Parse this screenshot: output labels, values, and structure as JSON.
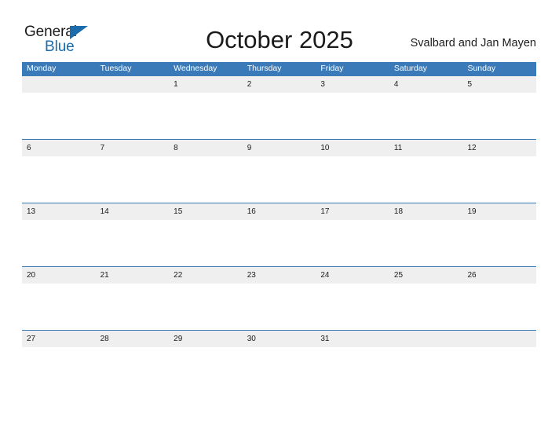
{
  "logo": {
    "text_dark": "General",
    "text_blue": "Blue",
    "triangle_icon": "triangle-icon",
    "brand_blue": "#1b6cac"
  },
  "header": {
    "title": "October 2025",
    "region": "Svalbard and Jan Mayen"
  },
  "colors": {
    "header_bar": "#3a7ab8",
    "date_band": "#efefef",
    "page_background": "#ffffff",
    "text": "#1a1a1a"
  },
  "calendar": {
    "weekdays": [
      "Monday",
      "Tuesday",
      "Wednesday",
      "Thursday",
      "Friday",
      "Saturday",
      "Sunday"
    ],
    "weeks": [
      [
        "",
        "",
        "1",
        "2",
        "3",
        "4",
        "5"
      ],
      [
        "6",
        "7",
        "8",
        "9",
        "10",
        "11",
        "12"
      ],
      [
        "13",
        "14",
        "15",
        "16",
        "17",
        "18",
        "19"
      ],
      [
        "20",
        "21",
        "22",
        "23",
        "24",
        "25",
        "26"
      ],
      [
        "27",
        "28",
        "29",
        "30",
        "31",
        "",
        ""
      ]
    ]
  }
}
